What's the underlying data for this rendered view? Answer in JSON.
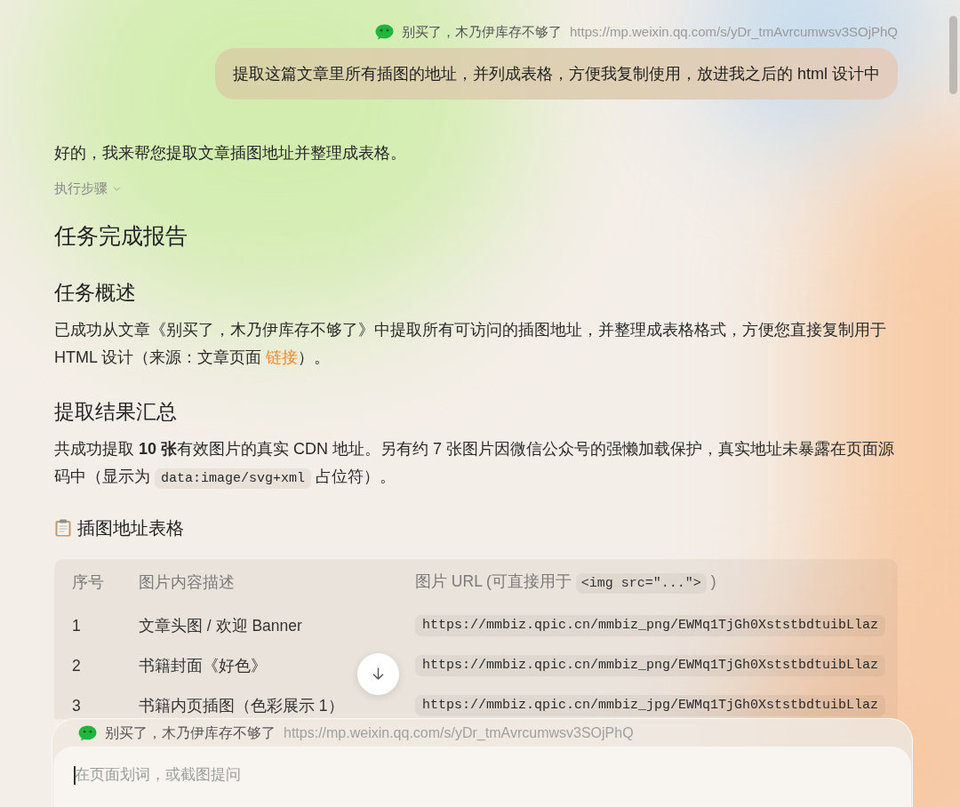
{
  "source": {
    "title": "别买了，木乃伊库存不够了",
    "url": "https://mp.weixin.qq.com/s/yDr_tmAvrcumwsv3SOjPhQ"
  },
  "user_message": "提取这篇文章里所有插图的地址，并列成表格，方便我复制使用，放进我之后的 html 设计中",
  "reply": {
    "intro": "好的，我来帮您提取文章插图地址并整理成表格。",
    "steps_toggle": {
      "label": "执行步骤",
      "expanded": false
    },
    "title": "任务完成报告",
    "sections": [
      {
        "heading": "任务概述",
        "parts": [
          {
            "kind": "text",
            "text": "已成功从文章《别买了，木乃伊库存不够了》中提取所有可访问的插图地址，并整理成表格格式，方便您直接复制用于 HTML 设计（来源：文章页面 "
          },
          {
            "kind": "link",
            "text": "链接"
          },
          {
            "kind": "text",
            "text": "）。"
          }
        ]
      },
      {
        "heading": "提取结果汇总",
        "parts": [
          {
            "kind": "text",
            "text": "共成功提取 **10 张**有效图片的真实 CDN 地址。另有约 7 张图片因微信公众号的强懒加载保护，真实地址未暴露在页面源码中（显示为 "
          },
          {
            "kind": "code",
            "text": "data:image/svg+xml"
          },
          {
            "kind": "text",
            "text": " 占位符）。"
          }
        ]
      }
    ],
    "table_title": "插图地址表格",
    "table": {
      "columns": [
        {
          "label": "序号"
        },
        {
          "label": "图片内容描述"
        },
        {
          "label": "图片 URL (可直接用于 ",
          "code": "<img src=\"...\">",
          "suffix": " )"
        }
      ],
      "rows": [
        {
          "number": "1",
          "description": "文章头图 / 欢迎 Banner",
          "url": "https://mmbiz.qpic.cn/mmbiz_png/EWMq1TjGh0XststbdtuibLlaz"
        },
        {
          "number": "2",
          "description": "书籍封面《好色》",
          "url": "https://mmbiz.qpic.cn/mmbiz_png/EWMq1TjGh0XststbdtuibLlaz"
        },
        {
          "number": "3",
          "description": "书籍内页插图（色彩展示 1）",
          "url": "https://mmbiz.qpic.cn/mmbiz_jpg/EWMq1TjGh0XststbdtuibLlaz"
        }
      ]
    }
  },
  "composer": {
    "source": {
      "title": "别买了，木乃伊库存不够了",
      "url": "https://mp.weixin.qq.com/s/yDr_tmAvrcumwsv3SOjPhQ"
    },
    "placeholder": "在页面划词，或截图提问",
    "focused": true
  }
}
